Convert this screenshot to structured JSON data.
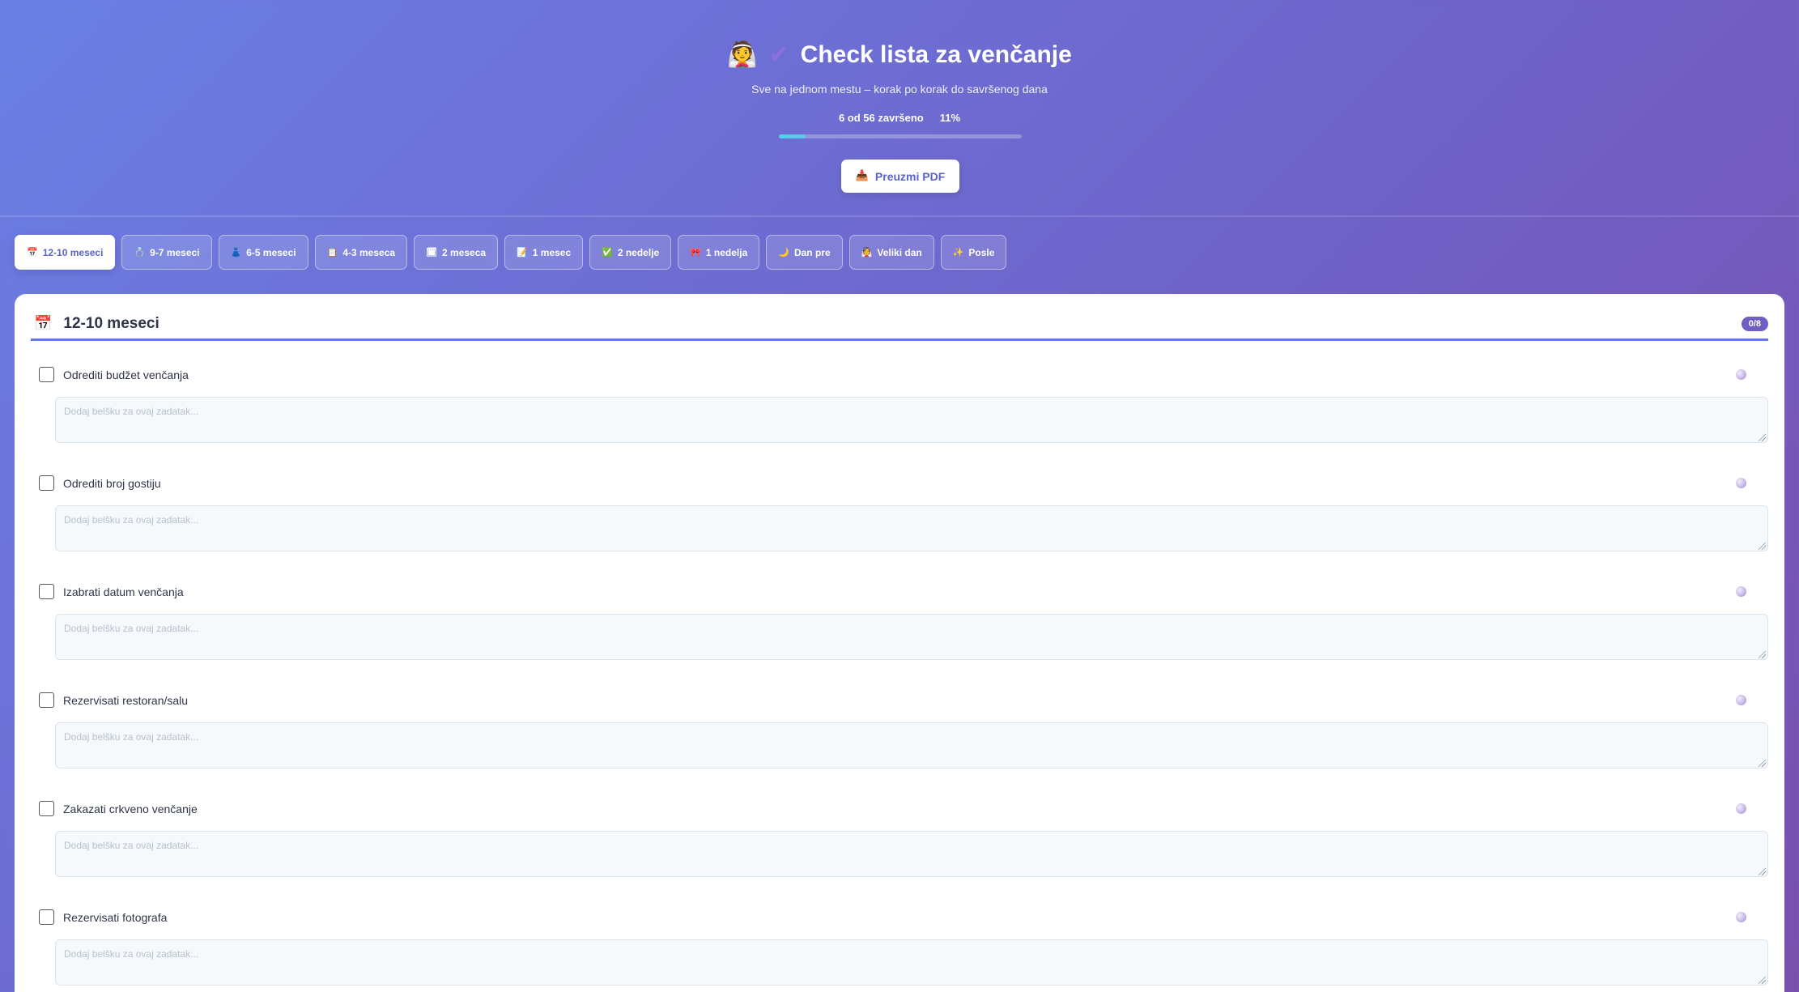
{
  "header": {
    "icon_emoji": "👰",
    "icon_check": "✔",
    "title": "Check lista za venčanje",
    "subtitle": "Sve na jednom mestu – korak po korak do savršenog dana",
    "progress_label": "6 od 56 završeno",
    "progress_percent_label": "11%",
    "progress_fraction": 0.11,
    "pdf_button_icon": "📥",
    "pdf_button_label": "Preuzmi PDF"
  },
  "tabs": [
    {
      "icon": "📅",
      "label": "12-10 meseci",
      "active": true
    },
    {
      "icon": "💍",
      "label": "9-7 meseci",
      "active": false
    },
    {
      "icon": "👗",
      "label": "6-5 meseci",
      "active": false
    },
    {
      "icon": "📋",
      "label": "4-3 meseca",
      "active": false
    },
    {
      "icon": "🗓",
      "label": "2 meseca",
      "active": false
    },
    {
      "icon": "📝",
      "label": "1 mesec",
      "active": false
    },
    {
      "icon": "✅",
      "label": "2 nedelje",
      "active": false
    },
    {
      "icon": "🎀",
      "label": "1 nedelja",
      "active": false
    },
    {
      "icon": "🌙",
      "label": "Dan pre",
      "active": false
    },
    {
      "icon": "👰",
      "label": "Veliki dan",
      "active": false
    },
    {
      "icon": "✨",
      "label": "Posle",
      "active": false
    }
  ],
  "section": {
    "icon": "📅",
    "title": "12-10 meseci",
    "count_badge": "0/8",
    "accent_color": "#6676df"
  },
  "tasks": [
    {
      "label": "Odrediti budžet venčanja",
      "note_placeholder": "Dodaj belšku za ovaj zadatak...",
      "checked": false
    },
    {
      "label": "Odrediti broj gostiju",
      "note_placeholder": "Dodaj belšku za ovaj zadatak...",
      "checked": false
    },
    {
      "label": "Izabrati datum venčanja",
      "note_placeholder": "Dodaj belšku za ovaj zadatak...",
      "checked": false
    },
    {
      "label": "Rezervisati restoran/salu",
      "note_placeholder": "Dodaj belšku za ovaj zadatak...",
      "checked": false
    },
    {
      "label": "Zakazati crkveno venčanje",
      "note_placeholder": "Dodaj belšku za ovaj zadatak...",
      "checked": false
    },
    {
      "label": "Rezervisati fotografa",
      "note_placeholder": "Dodaj belšku za ovaj zadatak...",
      "checked": false
    }
  ],
  "colors": {
    "brand_gradient_start": "#6a7fe4",
    "brand_gradient_end": "#7a4fae",
    "progress_fill": "#4fd2e8",
    "badge_bg": "#6d5fc4"
  }
}
